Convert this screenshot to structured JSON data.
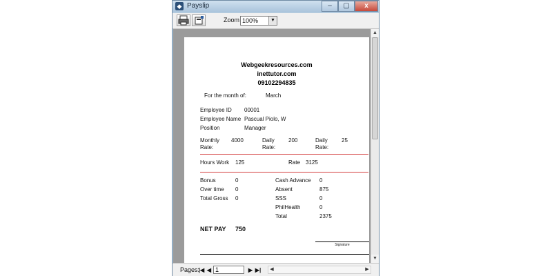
{
  "window": {
    "title": "Payslip",
    "close_symbol": "x",
    "min_symbol": "–",
    "max_symbol": "▢"
  },
  "toolbar": {
    "zoom_label": "Zoom",
    "zoom_value": "100%"
  },
  "payslip": {
    "company": [
      "Webgeekresources.com",
      "inettutor.com",
      "09102294835"
    ],
    "month_label": "For the month of:",
    "month_value": "March",
    "employee_id_label": "Employee ID",
    "employee_id": "00001",
    "employee_name_label": "Employee Name",
    "employee_name": "Pascual Piolo, W",
    "position_label": "Position",
    "position": "Manager",
    "monthly_rate_label": "Monthly Rate:",
    "monthly_rate": "4000",
    "daily_rate_label": "Daily Rate:",
    "daily_rate": "200",
    "daily_rate2_label": "Daily Rate:",
    "daily_rate2": "25",
    "hours_work_label": "Hours Work",
    "hours_work": "125",
    "rate_label": "Rate",
    "rate": "3125",
    "bonus_label": "Bonus",
    "bonus": "0",
    "overtime_label": "Over time",
    "overtime": "0",
    "total_gross_label": "Total Gross",
    "total_gross": "0",
    "cash_advance_label": "Cash Advance",
    "cash_advance": "0",
    "absent_label": "Absent",
    "absent": "875",
    "sss_label": "SSS",
    "sss": "0",
    "philhealth_label": "PhilHealth",
    "philhealth": "0",
    "total_label": "Total",
    "total": "2375",
    "net_pay_label": "NET PAY",
    "net_pay": "750",
    "signature_label": "Signature"
  },
  "statusbar": {
    "pages_label": "Pages:",
    "page_value": "1"
  },
  "colors": {
    "divider_red": "#d23b3b",
    "window_frame": "#b7cde0"
  }
}
